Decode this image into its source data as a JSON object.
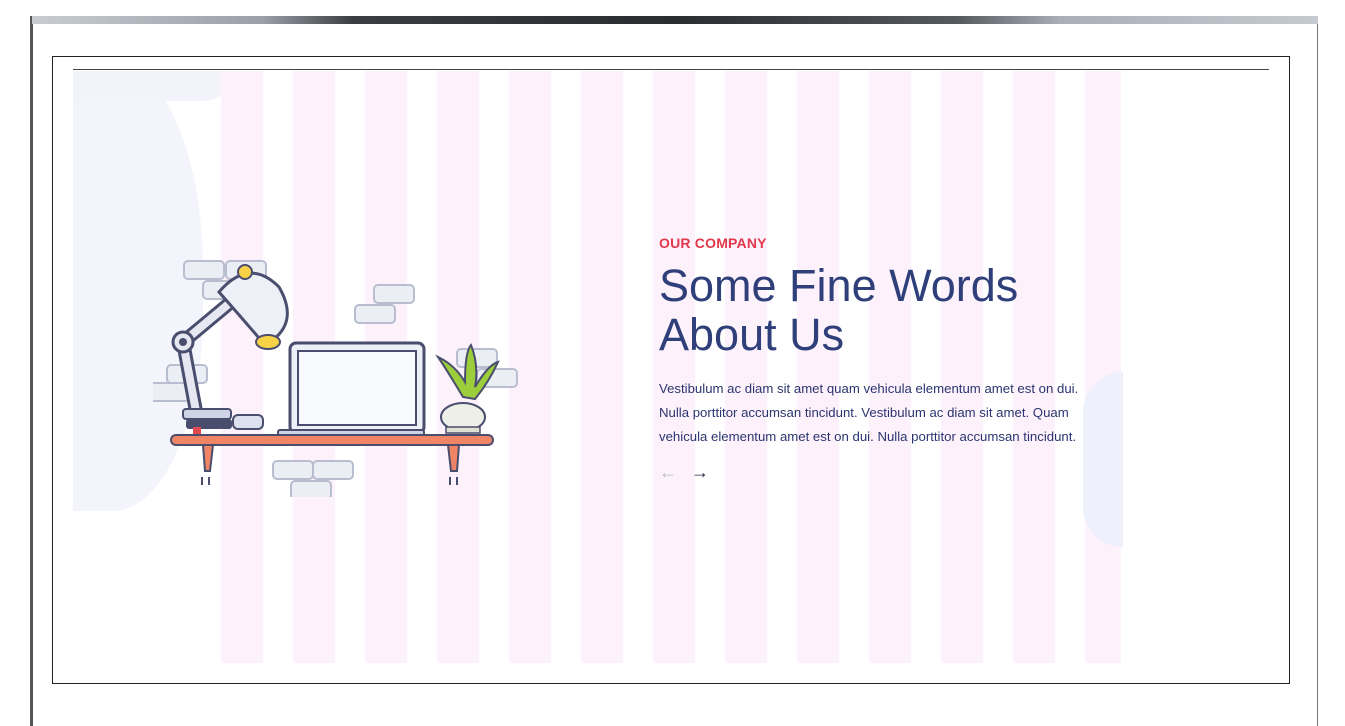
{
  "section": {
    "eyebrow": "OUR COMPANY",
    "heading_line1": "Some Fine Words",
    "heading_line2": "About Us",
    "body": "Vestibulum ac diam sit amet quam vehicula elementum amet est on dui. Nulla porttitor accumsan tincidunt. Vestibulum ac diam sit amet. Quam vehicula elementum amet est on dui. Nulla porttitor accumsan tincidunt."
  },
  "nav": {
    "prev_icon": "←",
    "next_icon": "→"
  },
  "colors": {
    "eyebrow": "#e2384c",
    "heading": "#2f3f7a",
    "body": "#2b3570",
    "stripe": "#fdf1fb"
  },
  "illustration": {
    "icons": [
      "desk-lamp-icon",
      "laptop-icon",
      "potted-plant-icon",
      "books-icon",
      "wall-bricks-icon"
    ]
  }
}
